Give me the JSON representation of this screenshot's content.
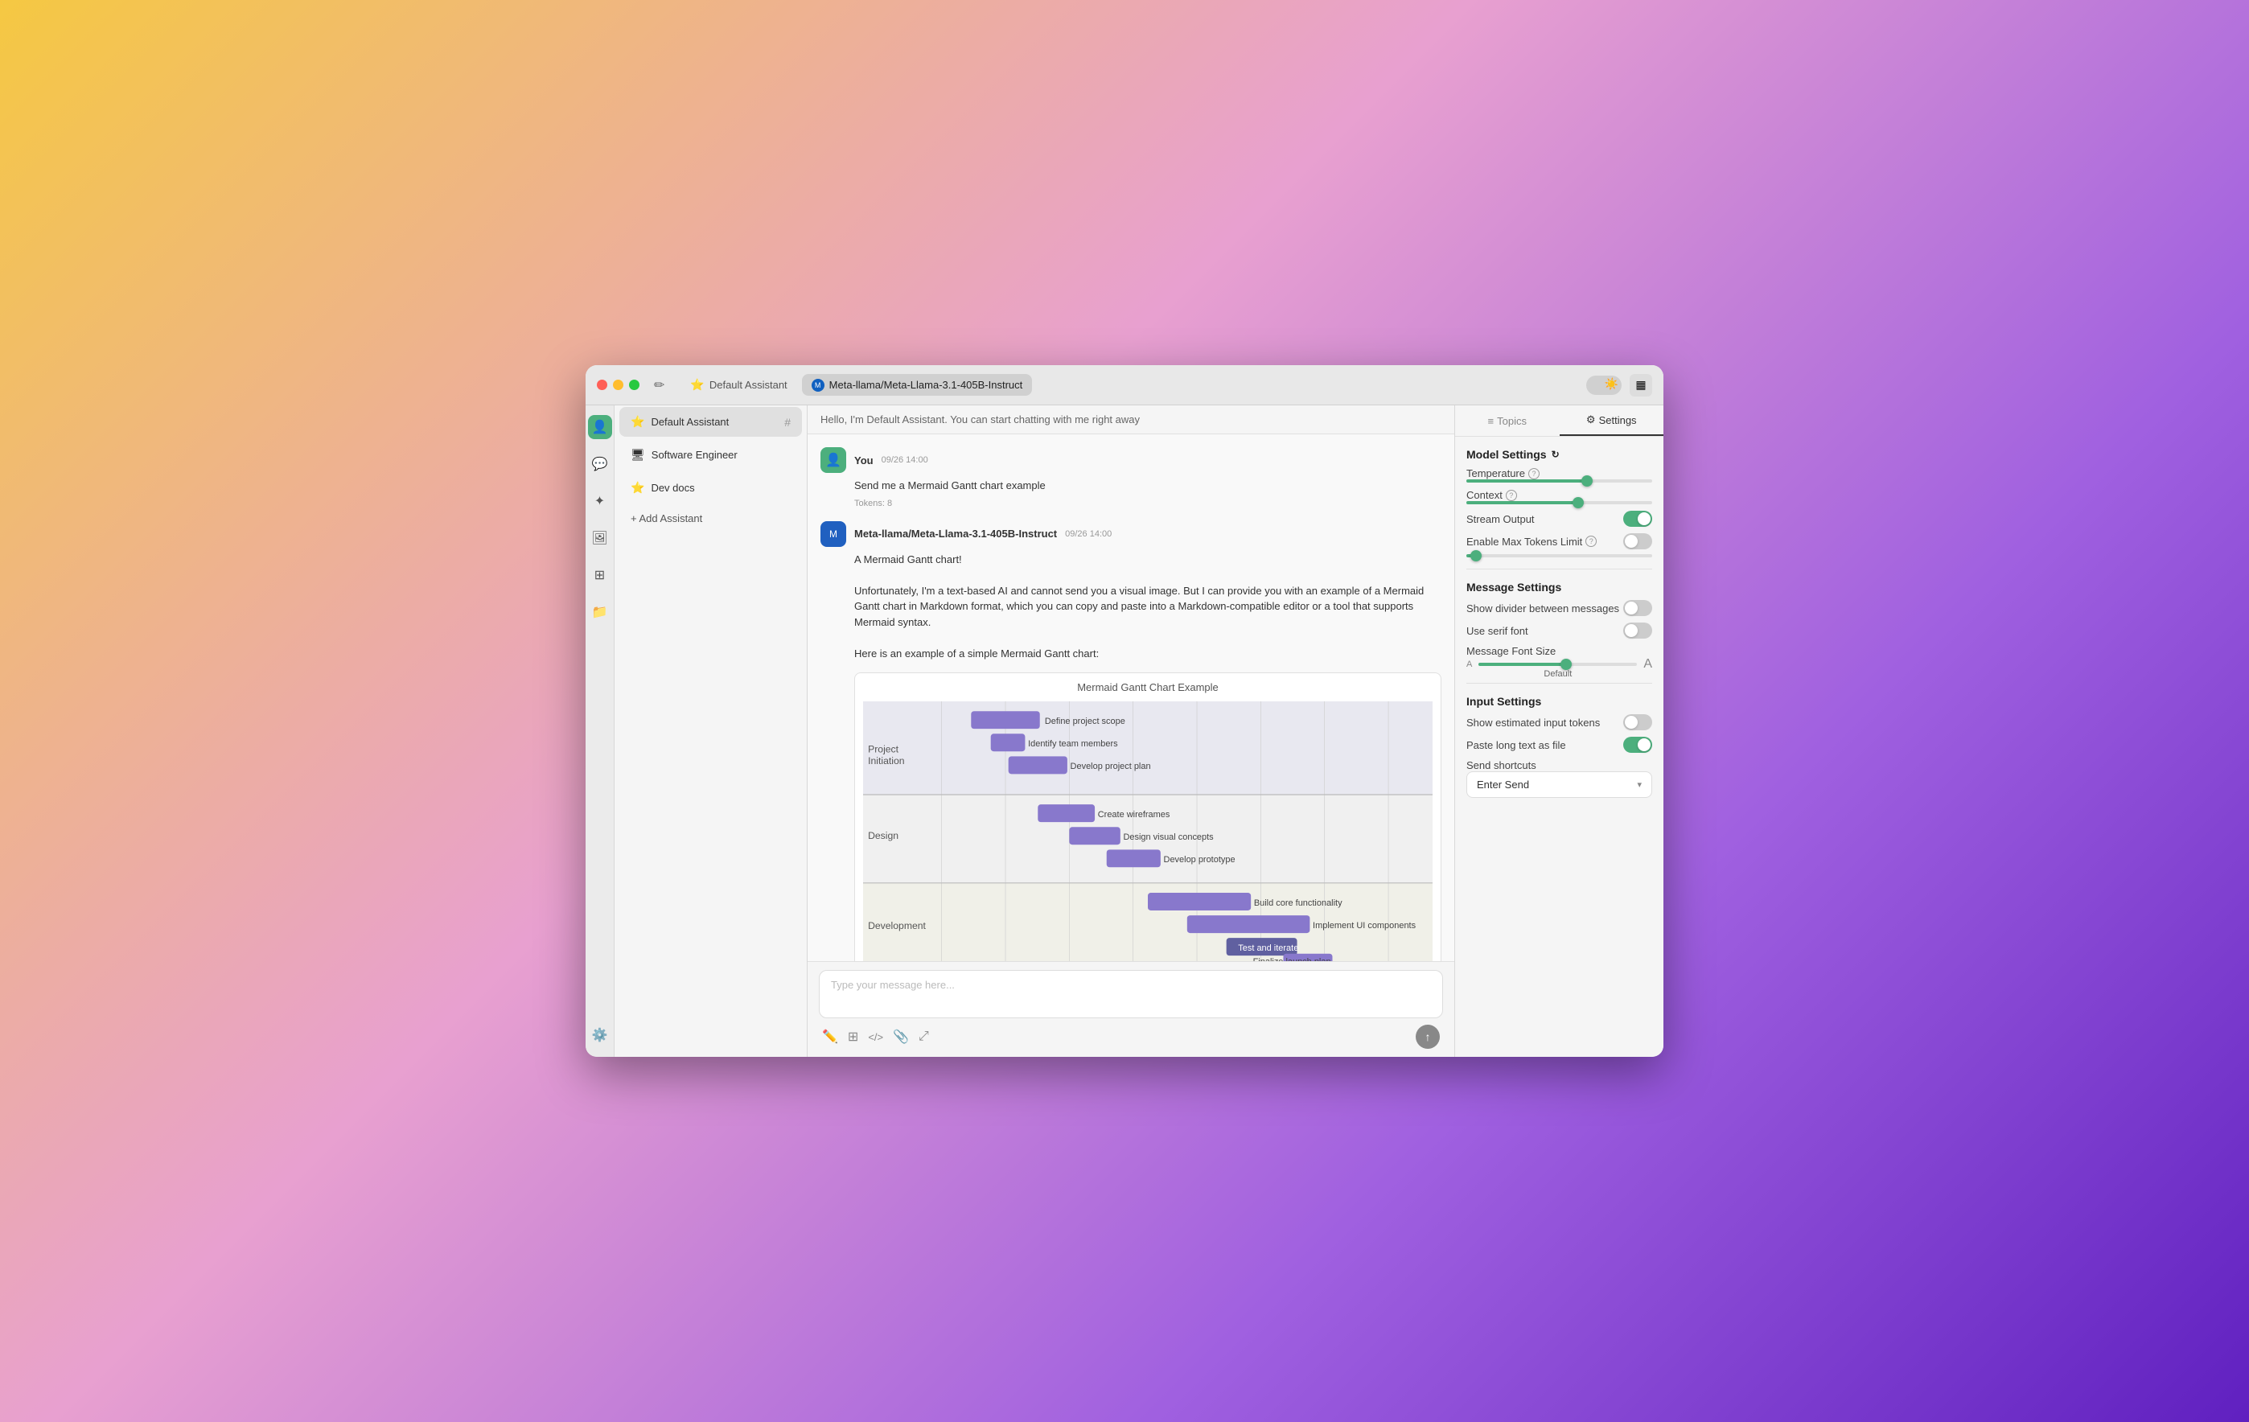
{
  "window": {
    "title": "Default Assistant"
  },
  "titlebar": {
    "tabs": [
      {
        "id": "default",
        "icon": "⭐",
        "label": "Default Assistant",
        "active": false
      },
      {
        "id": "meta",
        "icon": "🔵",
        "label": "Meta-llama/Meta-Llama-3.1-405B-Instruct",
        "active": true
      }
    ],
    "compose_icon": "✏️",
    "sidebar_toggle": "▦"
  },
  "sidebar": {
    "items": [
      {
        "id": "profile",
        "icon": "👤",
        "active": true
      },
      {
        "id": "chat",
        "icon": "💬",
        "active": false
      },
      {
        "id": "sparkle",
        "icon": "✦",
        "active": false
      },
      {
        "id": "image",
        "icon": "🖼",
        "active": false
      },
      {
        "id": "grid",
        "icon": "⊞",
        "active": false
      },
      {
        "id": "folder",
        "icon": "📁",
        "active": false
      }
    ],
    "settings": {
      "id": "settings",
      "icon": "⚙️"
    }
  },
  "conversations": {
    "items": [
      {
        "id": "default-assistant",
        "icon": "⭐",
        "label": "Default Assistant",
        "active": true,
        "hash": true
      },
      {
        "id": "software-engineer",
        "icon": "🖥",
        "label": "Software Engineer",
        "active": false
      },
      {
        "id": "dev-docs",
        "icon": "⭐",
        "label": "Dev docs",
        "active": false
      }
    ],
    "add_label": "+ Add Assistant"
  },
  "chat": {
    "header": "Hello, I'm Default Assistant. You can start chatting with me right away",
    "messages": [
      {
        "id": "user-msg",
        "role": "user",
        "name": "You",
        "time": "09/26 14:00",
        "avatar": "👤",
        "content": "Send me a Mermaid Gantt chart example",
        "tokens": "Tokens: 8"
      },
      {
        "id": "ai-msg",
        "role": "ai",
        "name": "Meta-llama/Meta-Llama-3.1-405B-Instruct",
        "time": "09/26 14:00",
        "avatar": "M",
        "content_lines": [
          "A Mermaid Gantt chart!",
          "",
          "Unfortunately, I'm a text-based AI and cannot send you a visual image. But I can provide you with an example of a Mermaid Gantt chart in Markdown format, which you can copy and paste into a Markdown-compatible editor or a tool that supports Mermaid syntax.",
          "",
          "Here is an example of a simple Mermaid Gantt chart:"
        ]
      }
    ],
    "gantt": {
      "title": "Mermaid Gantt Chart Example",
      "sections": [
        {
          "name": "Project Initiation",
          "tasks": [
            {
              "label": "Define project scope",
              "start": 0.05,
              "width": 0.12,
              "color": "#8080d0"
            },
            {
              "label": "Identify team members",
              "start": 0.1,
              "width": 0.06,
              "color": "#8080d0"
            },
            {
              "label": "Develop project plan",
              "start": 0.15,
              "width": 0.1,
              "color": "#8080d0"
            }
          ]
        },
        {
          "name": "Design",
          "tasks": [
            {
              "label": "Create wireframes",
              "start": 0.22,
              "width": 0.1,
              "color": "#8080d0"
            },
            {
              "label": "Design visual concepts",
              "start": 0.28,
              "width": 0.09,
              "color": "#8080d0"
            },
            {
              "label": "Develop prototype",
              "start": 0.35,
              "width": 0.09,
              "color": "#8080d0"
            }
          ]
        },
        {
          "name": "Development",
          "tasks": [
            {
              "label": "Build core functionality",
              "start": 0.42,
              "width": 0.18,
              "color": "#8080d0"
            },
            {
              "label": "Implement UI components",
              "start": 0.5,
              "width": 0.22,
              "color": "#8080d0"
            },
            {
              "label": "Test and iterate",
              "start": 0.6,
              "width": 0.12,
              "color": "#6060b0"
            },
            {
              "label": "Finalize launch plan",
              "start": 0.72,
              "width": 0.08,
              "color": "#8080d0"
            }
          ]
        }
      ]
    },
    "input_placeholder": "Type your message here...",
    "toolbar_icons": [
      "✏️",
      "⊞",
      "< >",
      "📎",
      "⤢"
    ]
  },
  "right_panel": {
    "tabs": [
      {
        "id": "topics",
        "icon": "≡",
        "label": "Topics",
        "active": false
      },
      {
        "id": "settings",
        "icon": "⚙",
        "label": "Settings",
        "active": true
      }
    ],
    "model_settings": {
      "title": "Model Settings",
      "temperature": {
        "label": "Temperature",
        "value": 0.65,
        "has_help": true
      },
      "context": {
        "label": "Context",
        "value": 0.6,
        "has_help": true
      },
      "stream_output": {
        "label": "Stream Output",
        "enabled": true
      },
      "enable_max_tokens": {
        "label": "Enable Max Tokens Limit",
        "enabled": false,
        "has_help": true
      }
    },
    "message_settings": {
      "title": "Message Settings",
      "show_divider": {
        "label": "Show divider between messages",
        "enabled": false
      },
      "use_serif": {
        "label": "Use serif font",
        "enabled": false
      },
      "font_size": {
        "label": "Message Font Size",
        "value": 0.55,
        "small_label": "A",
        "large_label": "A",
        "current": "Default"
      }
    },
    "input_settings": {
      "title": "Input Settings",
      "show_tokens": {
        "label": "Show estimated input tokens",
        "enabled": false
      },
      "paste_as_file": {
        "label": "Paste long text as file",
        "enabled": true
      },
      "send_shortcuts": {
        "label": "Send shortcuts",
        "value": "Enter Send"
      }
    }
  }
}
